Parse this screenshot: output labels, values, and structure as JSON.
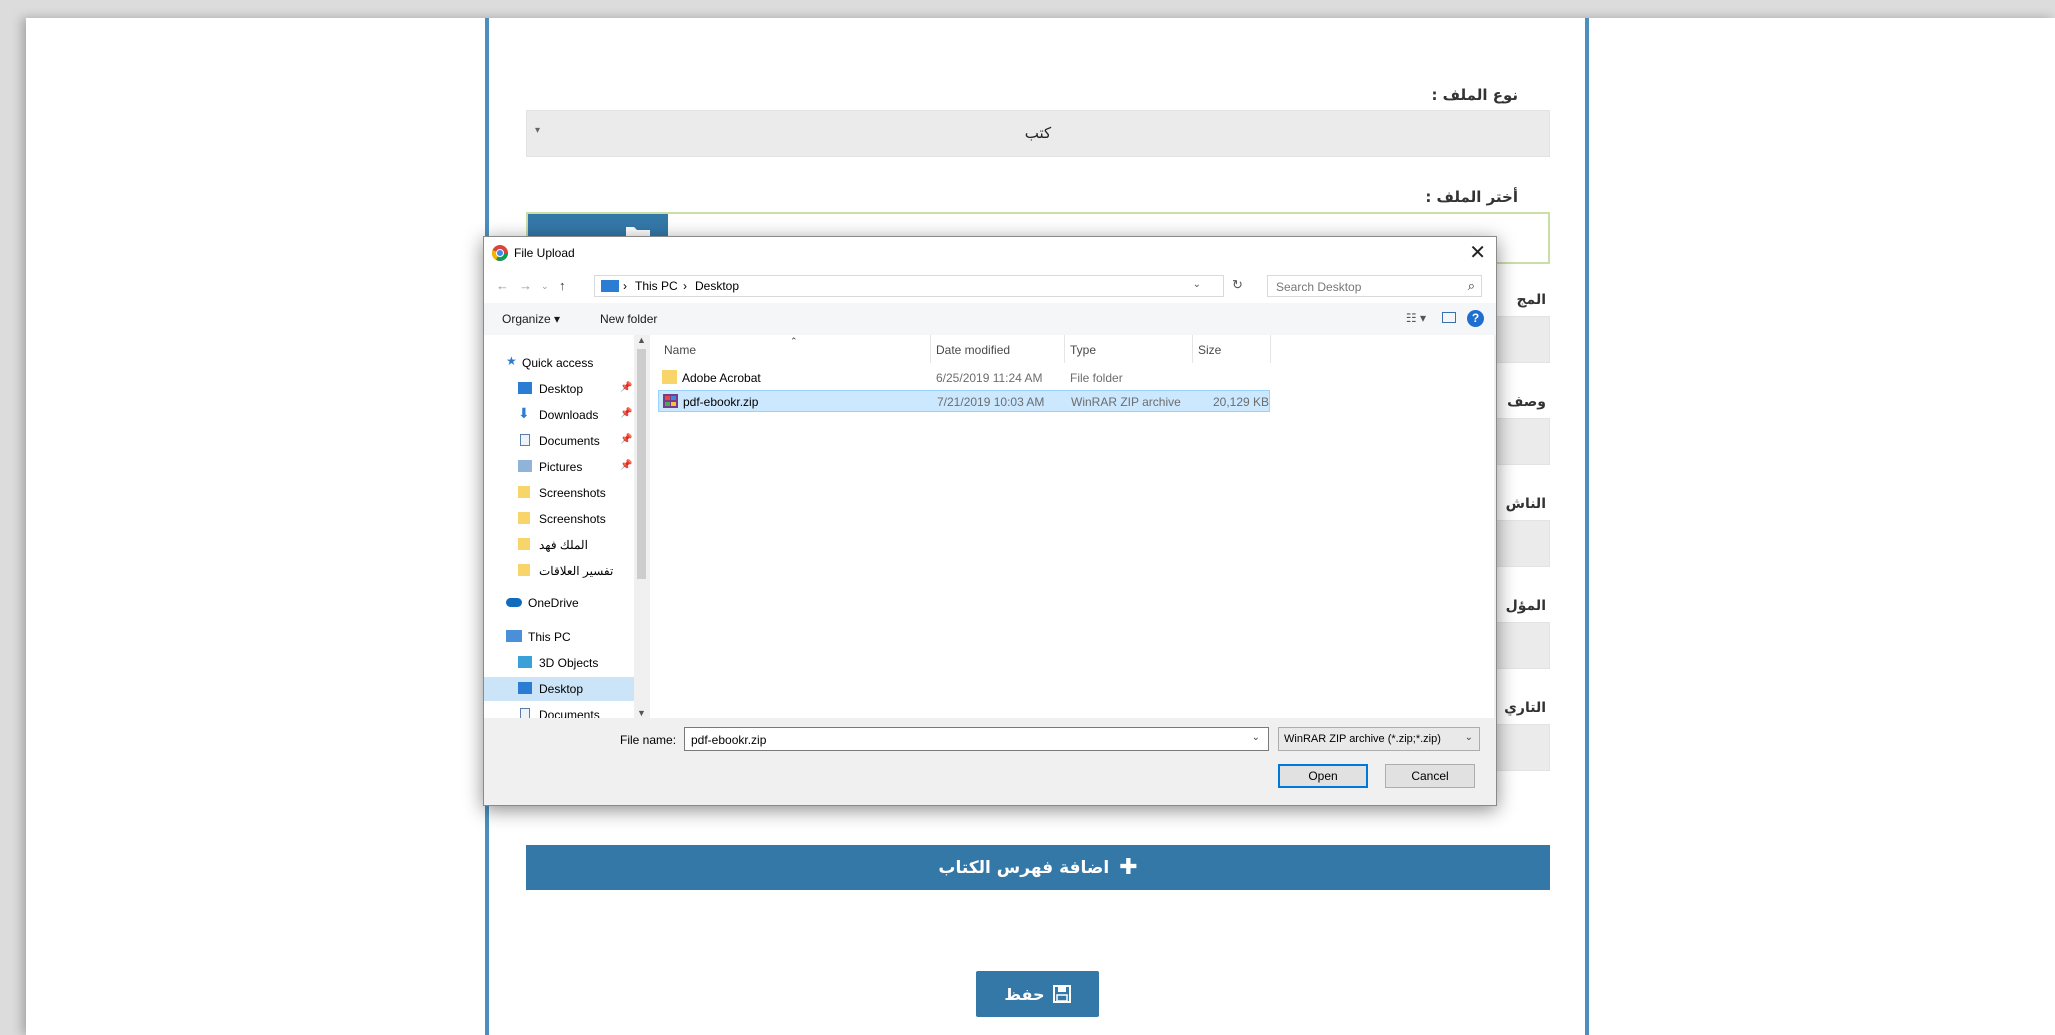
{
  "form": {
    "file_type_label": "نوع الملف :",
    "file_type_value": "كتب",
    "choose_file_label": "أختر الملف :",
    "partial_labels": [
      "المج",
      "وصف",
      "الناش",
      "المؤل",
      "التاري"
    ],
    "add_index_label": "اضافة فهرس الكتاب",
    "save_label": "حفظ"
  },
  "dialog": {
    "title": "File Upload",
    "breadcrumb": [
      "This PC",
      "Desktop"
    ],
    "search_placeholder": "Search Desktop",
    "organize_label": "Organize ▾",
    "new_folder_label": "New folder",
    "nav_items": [
      {
        "label": "Quick access",
        "icon": "star-icon",
        "pinned": false
      },
      {
        "label": "Desktop",
        "icon": "desktop-icon",
        "pinned": true
      },
      {
        "label": "Downloads",
        "icon": "download-icon",
        "pinned": true
      },
      {
        "label": "Documents",
        "icon": "document-icon",
        "pinned": true
      },
      {
        "label": "Pictures",
        "icon": "pictures-icon",
        "pinned": true
      },
      {
        "label": "Screenshots",
        "icon": "folder-icon",
        "pinned": false
      },
      {
        "label": "Screenshots",
        "icon": "folder-icon",
        "pinned": false
      },
      {
        "label": "الملك فهد",
        "icon": "folder-icon",
        "pinned": false
      },
      {
        "label": "تفسير العلاقات",
        "icon": "folder-icon",
        "pinned": false
      },
      {
        "label": "OneDrive",
        "icon": "cloud-icon",
        "pinned": false
      },
      {
        "label": "This PC",
        "icon": "computer-icon",
        "pinned": false
      },
      {
        "label": "3D Objects",
        "icon": "cube-icon",
        "pinned": false
      },
      {
        "label": "Desktop",
        "icon": "desktop-icon",
        "pinned": false,
        "selected": true
      },
      {
        "label": "Documents",
        "icon": "document-icon",
        "pinned": false
      }
    ],
    "columns": [
      "Name",
      "Date modified",
      "Type",
      "Size"
    ],
    "files": [
      {
        "name": "Adobe Acrobat",
        "date": "6/25/2019 11:24 AM",
        "type": "File folder",
        "size": "",
        "icon": "folder-icon"
      },
      {
        "name": "pdf-ebookr.zip",
        "date": "7/21/2019 10:03 AM",
        "type": "WinRAR ZIP archive",
        "size": "20,129 KB",
        "icon": "winrar-icon",
        "selected": true
      }
    ],
    "file_name_label": "File name:",
    "file_name_value": "pdf-ebookr.zip",
    "file_type_filter": "WinRAR ZIP archive (*.zip;*.zip)",
    "open_label": "Open",
    "cancel_label": "Cancel",
    "colors": {
      "accent": "#3478a8",
      "selection": "#cce8ff",
      "help": "#1e6fd0"
    }
  }
}
